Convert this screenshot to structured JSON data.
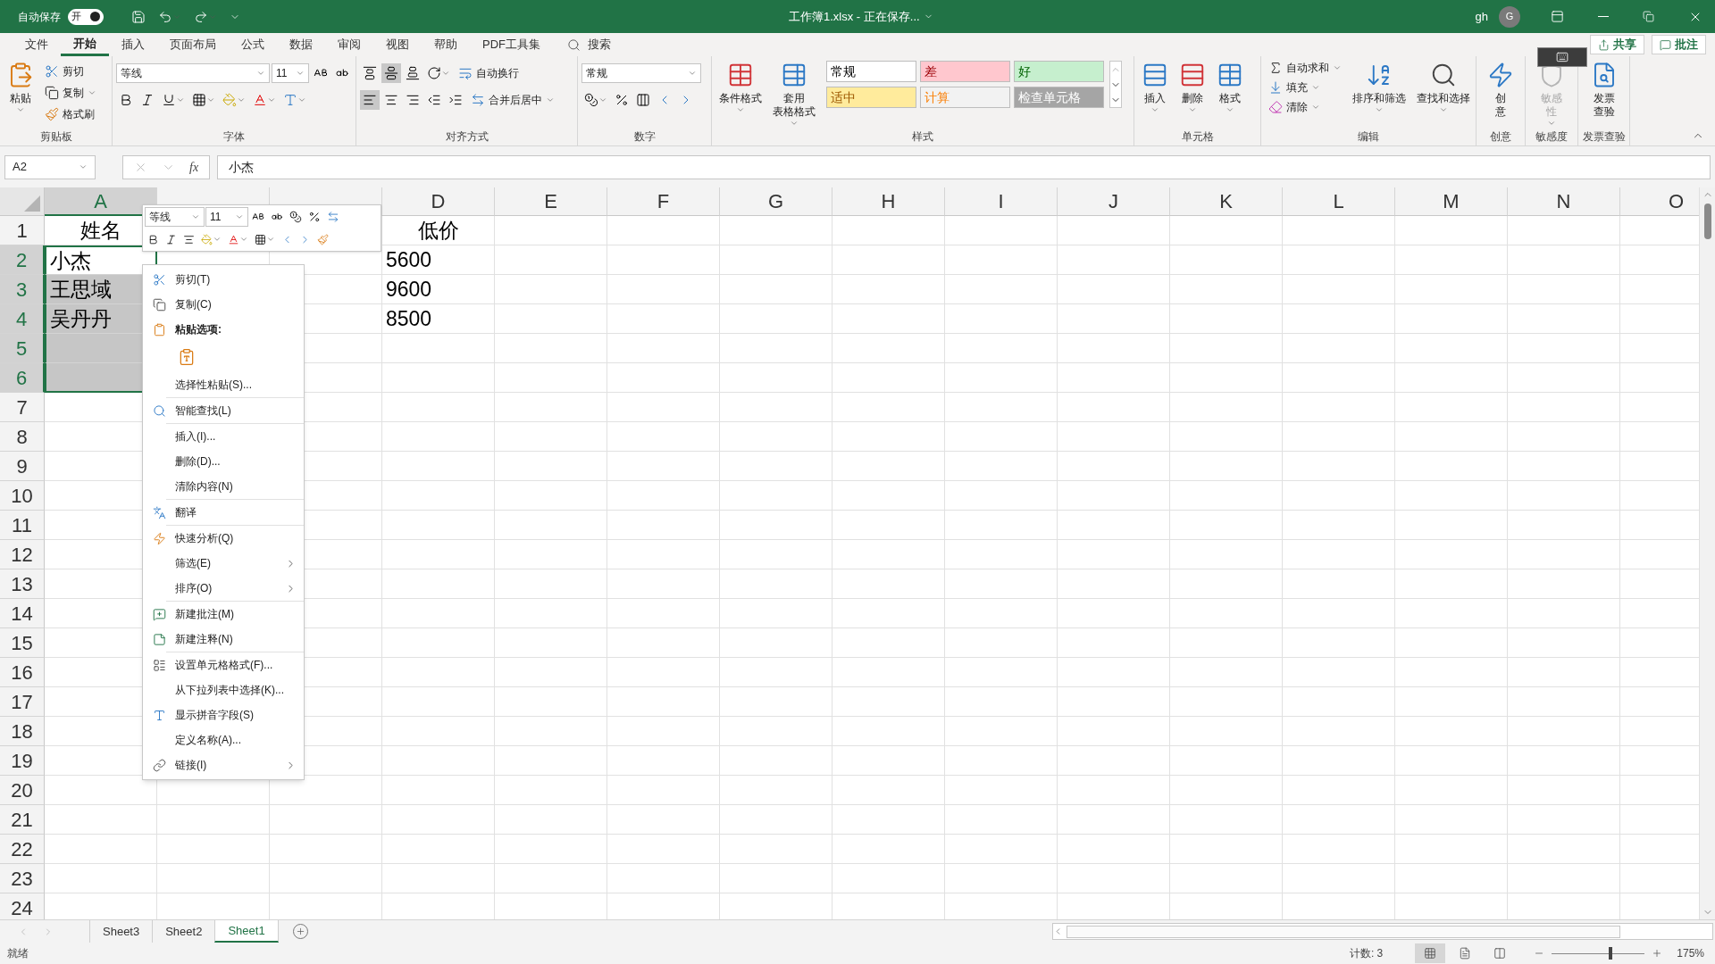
{
  "title_bar": {
    "autosave_label": "自动保存",
    "autosave": {
      "label": "开",
      "on": true
    },
    "title": "工作簿1.xlsx - 正在保存...",
    "user": "gh",
    "avatar": "G"
  },
  "menu_tabs": [
    {
      "label": "文件",
      "selected": false
    },
    {
      "label": "开始",
      "selected": true
    },
    {
      "label": "插入",
      "selected": false
    },
    {
      "label": "页面布局",
      "selected": false
    },
    {
      "label": "公式",
      "selected": false
    },
    {
      "label": "数据",
      "selected": false
    },
    {
      "label": "审阅",
      "selected": false
    },
    {
      "label": "视图",
      "selected": false
    },
    {
      "label": "帮助",
      "selected": false
    },
    {
      "label": "PDF工具集",
      "selected": false
    }
  ],
  "search": {
    "label": "搜索"
  },
  "actions": {
    "share": "共享",
    "comments": "批注"
  },
  "ribbon": {
    "clipboard": {
      "label": "剪贴板",
      "paste": "粘贴",
      "cut": "剪切",
      "copy": "复制",
      "format_painter": "格式刷"
    },
    "font": {
      "label": "字体",
      "font_name": "等线",
      "font_size": "11"
    },
    "alignment": {
      "label": "对齐方式",
      "wrap_text": "自动换行",
      "merge_center": "合并后居中"
    },
    "number": {
      "label": "数字",
      "format": "常规"
    },
    "styles": {
      "label": "样式",
      "conditional_format": [
        "条件格式"
      ],
      "table_format": [
        "套用",
        "表格格式"
      ],
      "gallery": [
        {
          "label": "常规",
          "color": "#ffffff"
        },
        {
          "label": "差",
          "color": "#ffc7ce"
        },
        {
          "label": "好",
          "color": "#c6efce"
        },
        {
          "label": "适中",
          "color": "#ffeb9c"
        },
        {
          "label": "计算",
          "color": "#f2f2f2"
        },
        {
          "label": "检查单元格",
          "color": "#a5a5a5"
        }
      ]
    },
    "cells": {
      "label": "单元格",
      "insert": "插入",
      "delete": "删除",
      "format": "格式"
    },
    "editing": {
      "label": "编辑",
      "autosum": "自动求和",
      "fill": "填充",
      "clear": "清除",
      "sort_filter": "排序和筛选",
      "find_select": "查找和选择"
    },
    "extra_groups": [
      {
        "label": "创意",
        "lines": [
          "创",
          "意"
        ],
        "disabled": false
      },
      {
        "label": "敏感度",
        "lines": [
          "敏感",
          "性"
        ],
        "disabled": true
      },
      {
        "label": "发票查验",
        "lines": [
          "发票",
          "查验"
        ],
        "disabled": false
      }
    ]
  },
  "formula_bar": {
    "name_box": "A2",
    "function_label": "fx",
    "formula": "小杰"
  },
  "grid": {
    "columns": [
      {
        "label": "A",
        "selected": true
      },
      {
        "selected": false
      },
      {
        "selected": false
      },
      {
        "label": "D",
        "selected": false
      },
      {
        "label": "E",
        "selected": false
      },
      {
        "label": "F",
        "selected": false
      },
      {
        "label": "G",
        "selected": false
      },
      {
        "label": "H",
        "selected": false
      },
      {
        "label": "I",
        "selected": false
      },
      {
        "label": "J",
        "selected": false
      },
      {
        "label": "K",
        "selected": false
      },
      {
        "label": "L",
        "selected": false
      },
      {
        "label": "M",
        "selected": false
      },
      {
        "label": "N",
        "selected": false
      },
      {
        "label": "O",
        "selected": false
      }
    ],
    "rows": [
      {
        "label": "1",
        "kind": "heading",
        "selected": false,
        "active": false,
        "cells": [
          "姓名",
          null,
          null,
          "低价"
        ]
      },
      {
        "label": "2",
        "kind": "data",
        "selected": true,
        "active": true,
        "cells": [
          "小杰",
          null,
          null,
          "5600"
        ]
      },
      {
        "label": "3",
        "kind": "data",
        "selected": true,
        "active": false,
        "cells": [
          "王思域",
          null,
          null,
          "9600"
        ]
      },
      {
        "label": "4",
        "kind": "data",
        "selected": true,
        "active": false,
        "cells": [
          "吴丹丹",
          null,
          null,
          "8500"
        ]
      },
      {
        "label": "5",
        "kind": "data",
        "selected": true,
        "active": false
      },
      {
        "label": "6",
        "kind": "data",
        "selected": true,
        "active": false
      },
      {
        "label": "7",
        "kind": "data",
        "selected": false,
        "active": false
      },
      {
        "label": "8",
        "kind": "data",
        "selected": false,
        "active": false
      },
      {
        "label": "9",
        "kind": "data",
        "selected": false,
        "active": false
      },
      {
        "label": "10",
        "kind": "data",
        "selected": false,
        "active": false
      },
      {
        "label": "11",
        "kind": "data",
        "selected": false,
        "active": false
      },
      {
        "label": "12",
        "kind": "data",
        "selected": false,
        "active": false
      },
      {
        "label": "13",
        "kind": "data",
        "selected": false,
        "active": false
      },
      {
        "label": "14",
        "kind": "data",
        "selected": false,
        "active": false
      },
      {
        "label": "15",
        "kind": "data",
        "selected": false,
        "active": false
      },
      {
        "label": "16",
        "kind": "data",
        "selected": false,
        "active": false
      },
      {
        "label": "17",
        "kind": "data",
        "selected": false,
        "active": false
      },
      {
        "label": "18",
        "kind": "data",
        "selected": false,
        "active": false
      },
      {
        "label": "19",
        "kind": "data",
        "selected": false,
        "active": false
      },
      {
        "label": "20",
        "kind": "data",
        "selected": false,
        "active": false
      },
      {
        "label": "21",
        "kind": "data",
        "selected": false,
        "active": false
      },
      {
        "label": "22",
        "kind": "data",
        "selected": false,
        "active": false
      },
      {
        "label": "23",
        "kind": "data",
        "selected": false,
        "active": false
      },
      {
        "label": "24",
        "kind": "data",
        "selected": false,
        "active": false
      }
    ]
  },
  "mini_toolbar": {
    "font_name": "等线",
    "font_size": "11"
  },
  "context_menu": {
    "groups": [
      [
        {
          "label": "剪切(T)",
          "kind": "item",
          "submenu": false
        },
        {
          "label": "复制(C)",
          "kind": "item",
          "submenu": false
        },
        {
          "label": "粘贴选项:",
          "kind": "heading"
        },
        {
          "kind": "paste-options"
        },
        {
          "label": "选择性粘贴(S)...",
          "kind": "item",
          "submenu": false
        }
      ],
      [
        {
          "label": "智能查找(L)",
          "kind": "item",
          "submenu": false
        }
      ],
      [
        {
          "label": "插入(I)...",
          "kind": "item",
          "submenu": false
        },
        {
          "label": "删除(D)...",
          "kind": "item",
          "submenu": false
        },
        {
          "label": "清除内容(N)",
          "kind": "item",
          "submenu": false
        }
      ],
      [
        {
          "label": "翻译",
          "kind": "item",
          "submenu": false
        }
      ],
      [
        {
          "label": "快速分析(Q)",
          "kind": "item",
          "submenu": false
        },
        {
          "label": "筛选(E)",
          "kind": "item",
          "submenu": true
        },
        {
          "label": "排序(O)",
          "kind": "item",
          "submenu": true
        }
      ],
      [
        {
          "label": "新建批注(M)",
          "kind": "item",
          "submenu": false
        },
        {
          "label": "新建注释(N)",
          "kind": "item",
          "submenu": false
        }
      ],
      [
        {
          "label": "设置单元格格式(F)...",
          "kind": "item",
          "submenu": false
        },
        {
          "label": "从下拉列表中选择(K)...",
          "kind": "item",
          "submenu": false
        },
        {
          "label": "显示拼音字段(S)",
          "kind": "item",
          "submenu": false
        },
        {
          "label": "定义名称(A)...",
          "kind": "item",
          "submenu": false
        },
        {
          "label": "链接(I)",
          "kind": "item",
          "submenu": true
        }
      ]
    ]
  },
  "sheet_tabs": [
    {
      "label": "Sheet3",
      "selected": false
    },
    {
      "label": "Sheet2",
      "selected": false
    },
    {
      "label": "Sheet1",
      "selected": true
    }
  ],
  "status_bar": {
    "status": "就绪",
    "count": "计数: 3",
    "views": [
      {
        "selected": true
      },
      {
        "selected": false
      },
      {
        "selected": false
      }
    ],
    "zoom": {
      "level": 0.64,
      "label": "175%"
    }
  }
}
